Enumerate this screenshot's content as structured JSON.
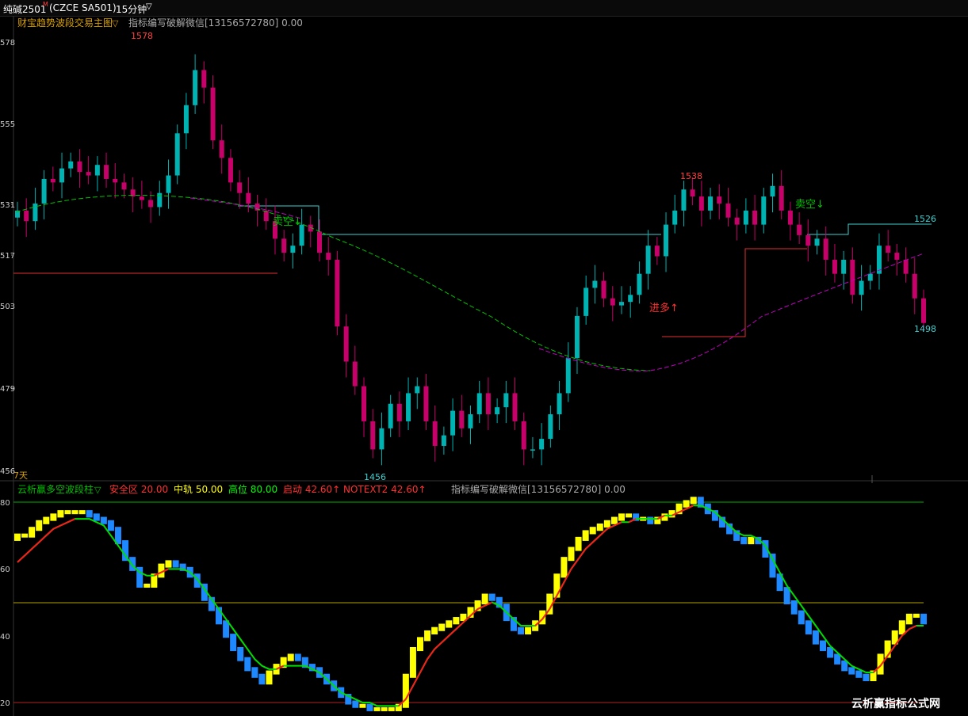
{
  "header": {
    "symbol": "纯碱2501",
    "symbol_mark": "M",
    "code": "(CZCE SA501)",
    "period": "15分钟"
  },
  "main_panel": {
    "indicator_name": "财宝趋势波段交易主图",
    "watermark_text": "指标编写破解微信[13156572780] 0.00",
    "price_ticks": [
      "578",
      "555",
      "531",
      "517",
      "503",
      "479",
      "456"
    ],
    "corner_label": "7天",
    "annotations": {
      "high_label": "1578",
      "low_label": "1456",
      "peak2_label": "1538",
      "right_high_label": "1526",
      "right_low_label": "1498",
      "sell1": "卖空↓",
      "sell2": "卖空↓",
      "buy1": "进多↑"
    },
    "colors": {
      "up": "#00b3b3",
      "down": "#c8006a",
      "ma_green": "#00c000",
      "ma_magenta": "#c000c0",
      "cyan_line": "#40d0d0",
      "red_line": "#e03030"
    }
  },
  "sub_panel": {
    "indicator_name": "云析赢多空波段柱",
    "legend": [
      {
        "label": "安全区",
        "value": "20.00",
        "color": "#ff3030"
      },
      {
        "label": "中轨",
        "value": "50.00",
        "color": "#ffff00"
      },
      {
        "label": "高位",
        "value": "80.00",
        "color": "#00ff00"
      },
      {
        "label": "启动",
        "value": "42.60↑",
        "color": "#ff3030"
      },
      {
        "label": "NOTEXT2",
        "value": "42.60↑",
        "color": "#ff3030"
      }
    ],
    "watermark_text": "指标编写破解微信[13156572780] 0.00",
    "ticks": [
      "80",
      "60",
      "40",
      "20"
    ]
  },
  "brand": "云析赢指标公式网",
  "chart_data": [
    {
      "type": "candlestick",
      "title": "纯碱2501 (CZCE SA501) 15分钟",
      "ylim": [
        1456,
        1578
      ],
      "y_ticks": [
        1578,
        1555,
        1531,
        1517,
        1503,
        1479,
        1456
      ],
      "close_series": [
        1530,
        1527,
        1532,
        1539,
        1538,
        1542,
        1544,
        1541,
        1540,
        1543,
        1539,
        1538,
        1536,
        1534,
        1533,
        1531,
        1535,
        1540,
        1552,
        1560,
        1570,
        1565,
        1550,
        1545,
        1538,
        1535,
        1532,
        1530,
        1527,
        1522,
        1518,
        1520,
        1526,
        1524,
        1518,
        1516,
        1497,
        1487,
        1480,
        1470,
        1462,
        1468,
        1475,
        1470,
        1478,
        1480,
        1470,
        1463,
        1466,
        1473,
        1468,
        1472,
        1478,
        1472,
        1474,
        1478,
        1470,
        1462,
        1462,
        1465,
        1472,
        1478,
        1488,
        1500,
        1508,
        1510,
        1505,
        1503,
        1504,
        1506,
        1512,
        1520,
        1517,
        1526,
        1530,
        1536,
        1534,
        1530,
        1534,
        1532,
        1528,
        1526,
        1530,
        1526,
        1534,
        1537,
        1530,
        1526,
        1523,
        1520,
        1522,
        1516,
        1512,
        1516,
        1506,
        1510,
        1512,
        1520,
        1518,
        1516,
        1512,
        1505,
        1498
      ],
      "annotations": [
        "1578",
        "1456",
        "1538",
        "1526",
        "1498"
      ]
    },
    {
      "type": "bar",
      "title": "云析赢多空波段柱",
      "ylim": [
        17,
        82
      ],
      "reference_lines": [
        20,
        50,
        80
      ],
      "values": [
        70,
        70,
        72,
        74,
        75,
        76,
        77,
        77,
        77,
        77,
        76,
        75,
        74,
        72,
        68,
        63,
        60,
        55,
        55,
        58,
        61,
        62,
        61,
        60,
        58,
        55,
        51,
        48,
        44,
        40,
        36,
        33,
        30,
        28,
        26,
        29,
        31,
        33,
        34,
        33,
        31,
        30,
        28,
        26,
        24,
        22,
        20,
        19,
        19,
        18,
        18,
        18,
        18,
        19,
        28,
        36,
        39,
        41,
        42,
        43,
        44,
        45,
        46,
        48,
        50,
        52,
        51,
        49,
        45,
        42,
        41,
        42,
        44,
        47,
        52,
        58,
        63,
        66,
        69,
        71,
        72,
        73,
        74,
        75,
        76,
        76,
        75,
        75,
        74,
        75,
        76,
        77,
        79,
        80,
        81,
        79,
        77,
        75,
        73,
        71,
        69,
        68,
        69,
        68,
        64,
        58,
        54,
        50,
        47,
        44,
        41,
        38,
        36,
        34,
        32,
        30,
        29,
        28,
        27,
        29,
        34,
        38,
        41,
        44,
        46,
        46,
        44
      ],
      "signal_line": [
        62,
        64,
        66,
        68,
        70,
        72,
        73,
        74,
        75,
        75,
        75,
        74,
        73,
        70,
        67,
        64,
        61,
        59,
        58,
        58,
        59,
        60,
        60,
        60,
        59,
        57,
        54,
        51,
        48,
        45,
        42,
        39,
        36,
        33,
        31,
        30,
        30,
        31,
        31,
        31,
        31,
        30,
        29,
        27,
        25,
        23,
        22,
        21,
        20,
        20,
        19,
        19,
        19,
        19,
        21,
        25,
        29,
        33,
        36,
        38,
        40,
        42,
        44,
        46,
        48,
        49,
        50,
        49,
        47,
        45,
        43,
        43,
        43,
        45,
        48,
        52,
        56,
        60,
        63,
        66,
        68,
        70,
        72,
        73,
        74,
        74,
        75,
        75,
        75,
        75,
        76,
        76,
        77,
        78,
        79,
        79,
        78,
        77,
        75,
        73,
        71,
        70,
        70,
        69,
        67,
        63,
        59,
        55,
        52,
        49,
        46,
        43,
        40,
        37,
        35,
        33,
        31,
        30,
        29,
        29,
        31,
        34,
        37,
        40,
        42,
        43,
        43
      ],
      "bar_colors": "rising=yellow, falling=blue"
    }
  ]
}
